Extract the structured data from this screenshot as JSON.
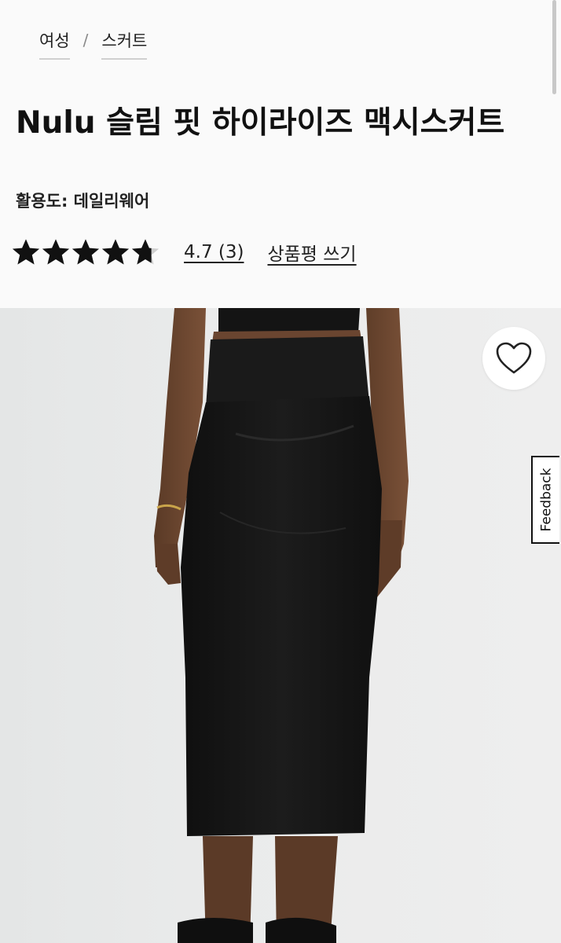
{
  "breadcrumb": {
    "items": [
      "여성",
      "스커트"
    ],
    "separator": "/"
  },
  "product": {
    "title": "Nulu 슬림 핏 하이라이즈 맥시스커트",
    "activity": "활용도: 데일리웨어"
  },
  "rating": {
    "value": 4.7,
    "max": 5,
    "text": "4.7 (3)",
    "write_review_label": "상품평 쓰기"
  },
  "wishlist": {
    "icon": "heart-outline-icon"
  },
  "feedback": {
    "label": "Feedback"
  },
  "colors": {
    "text": "#111111",
    "image_bg": "#e9eaea",
    "skirt": "#161616"
  }
}
